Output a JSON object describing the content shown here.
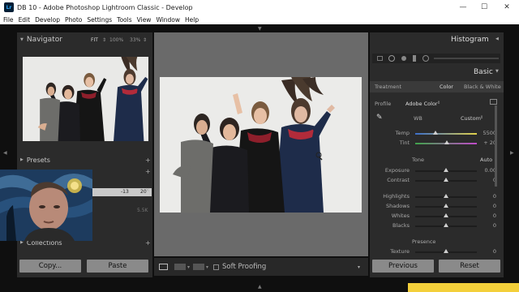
{
  "window": {
    "app_icon": "Lr",
    "title": "DB 10 - Adobe Photoshop Lightroom Classic - Develop",
    "minimize": "—",
    "maximize": "☐",
    "close": "✕"
  },
  "menu": {
    "file": "File",
    "edit": "Edit",
    "develop": "Develop",
    "photo": "Photo",
    "settings": "Settings",
    "tools": "Tools",
    "view": "View",
    "window": "Window",
    "help": "Help"
  },
  "left_panel": {
    "navigator": {
      "title": "Navigator",
      "zoom_fit": "FIT",
      "zoom_100": "100%",
      "zoom_33": "33%"
    },
    "presets": "Presets",
    "history_val1": "-13",
    "history_val2": "20",
    "history_val3": "5.5K",
    "collections": "Collections",
    "copy_button": "Copy...",
    "paste_button": "Paste"
  },
  "toolbar": {
    "soft_proofing": "Soft Proofing"
  },
  "right_panel": {
    "histogram": "Histogram",
    "basic": "Basic",
    "treatment_label": "Treatment",
    "treatment_color": "Color",
    "treatment_bw": "Black & White",
    "profile_label": "Profile",
    "profile_value": "Adobe Color",
    "wb_label": "WB",
    "wb_value": "Custom",
    "temp_label": "Temp",
    "temp_value": "5500",
    "tint_label": "Tint",
    "tint_value": "+ 20",
    "tone_label": "Tone",
    "tone_auto": "Auto",
    "exposure_label": "Exposure",
    "exposure_value": "0.00",
    "contrast_label": "Contrast",
    "contrast_value": "0",
    "highlights_label": "Highlights",
    "highlights_value": "0",
    "shadows_label": "Shadows",
    "shadows_value": "0",
    "whites_label": "Whites",
    "whites_value": "0",
    "blacks_label": "Blacks",
    "blacks_value": "0",
    "presence_label": "Presence",
    "texture_label": "Texture",
    "texture_value": "0",
    "previous_button": "Previous",
    "reset_button": "Reset"
  },
  "colors": {
    "panel_bg": "#2b2b2b",
    "center_bg": "#6a6a6a",
    "button_bg": "#8a8a8a",
    "accent_yellow": "#f3cf3a"
  }
}
